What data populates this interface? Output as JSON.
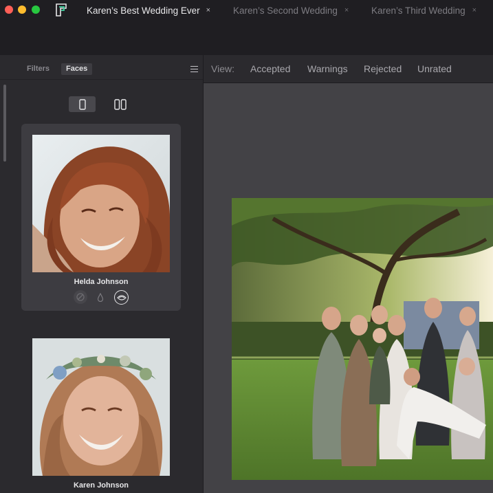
{
  "tabs": [
    {
      "label": "Karen’s Best Wedding Ever",
      "active": true
    },
    {
      "label": "Karen’s Second Wedding",
      "active": false
    },
    {
      "label": "Karen’s Third Wedding",
      "active": false
    }
  ],
  "tab_close_glyph": "×",
  "sidebar": {
    "tabs": {
      "filters": "Filters",
      "faces": "Faces"
    },
    "menu_icon": "hamburger-icon",
    "layout_options": [
      "single-column-icon",
      "two-column-icon"
    ]
  },
  "faces": [
    {
      "name": "Helda Johnson",
      "icons": [
        "no-blink-icon",
        "drop-icon",
        "eye-icon"
      ],
      "active_icon": "eye-icon"
    },
    {
      "name": "Karen Johnson",
      "icons": [
        "no-blink-icon",
        "drop-icon",
        "eye-icon"
      ]
    }
  ],
  "viewbar": {
    "label": "View:",
    "filters": [
      "Accepted",
      "Warnings",
      "Rejected",
      "Unrated"
    ]
  },
  "colors": {
    "titlebar": "#1f1e22",
    "sidebar": "#2b2a2e",
    "main_bg": "#434246",
    "selected_card": "#3d3c41"
  }
}
